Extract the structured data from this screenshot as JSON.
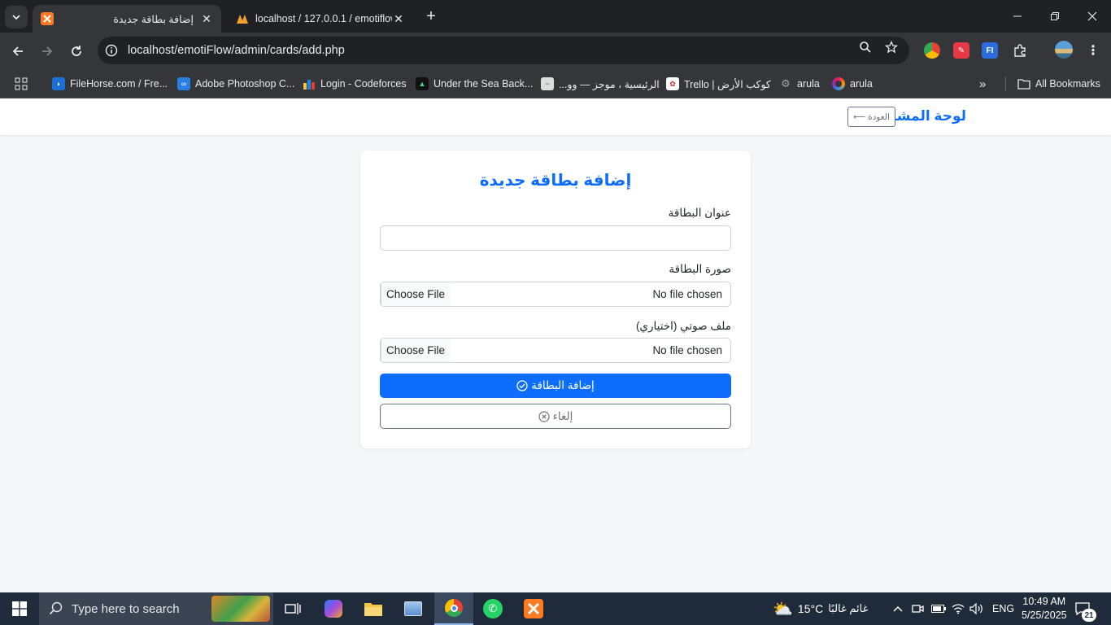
{
  "browser": {
    "tabs": [
      {
        "title": "إضافة بطاقة جديدة",
        "active": true
      },
      {
        "title": "localhost / 127.0.0.1 / emotiflow",
        "active": false
      }
    ],
    "url": "localhost/emotiFlow/admin/cards/add.php",
    "bookmarks": [
      {
        "label": "FileHorse.com / Fre..."
      },
      {
        "label": "Adobe Photoshop C..."
      },
      {
        "label": "Login - Codeforces"
      },
      {
        "label": "Under the Sea Back..."
      },
      {
        "label": "الرئيسية ، موجز — وو..."
      },
      {
        "label": "Trello | كوكب الأرض"
      },
      {
        "label": "arula"
      },
      {
        "label": "arula"
      }
    ],
    "all_bookmarks": "All Bookmarks"
  },
  "page": {
    "brand": "لوحة المشرف",
    "back_button": "العودة",
    "form_title": "إضافة بطاقة جديدة",
    "fields": {
      "title_label": "عنوان البطاقة",
      "title_value": "",
      "image_label": "صورة البطاقة",
      "image_file": "No file chosen",
      "audio_label": "ملف صوتي (اختياري)",
      "audio_file": "No file chosen",
      "choose_file": "Choose File"
    },
    "submit_button": "إضافة البطاقة",
    "cancel_button": "إلغاء"
  },
  "taskbar": {
    "search_placeholder": "Type here to search",
    "weather_temp": "15°C",
    "weather_desc": "غائم غالبًا",
    "language": "ENG",
    "time": "10:49 AM",
    "date": "5/25/2025",
    "notifications": "21"
  },
  "colors": {
    "primary": "#0d6efd",
    "secondary": "#6c757d",
    "chrome_dark": "#202124",
    "chrome_toolbar": "#35363a"
  }
}
